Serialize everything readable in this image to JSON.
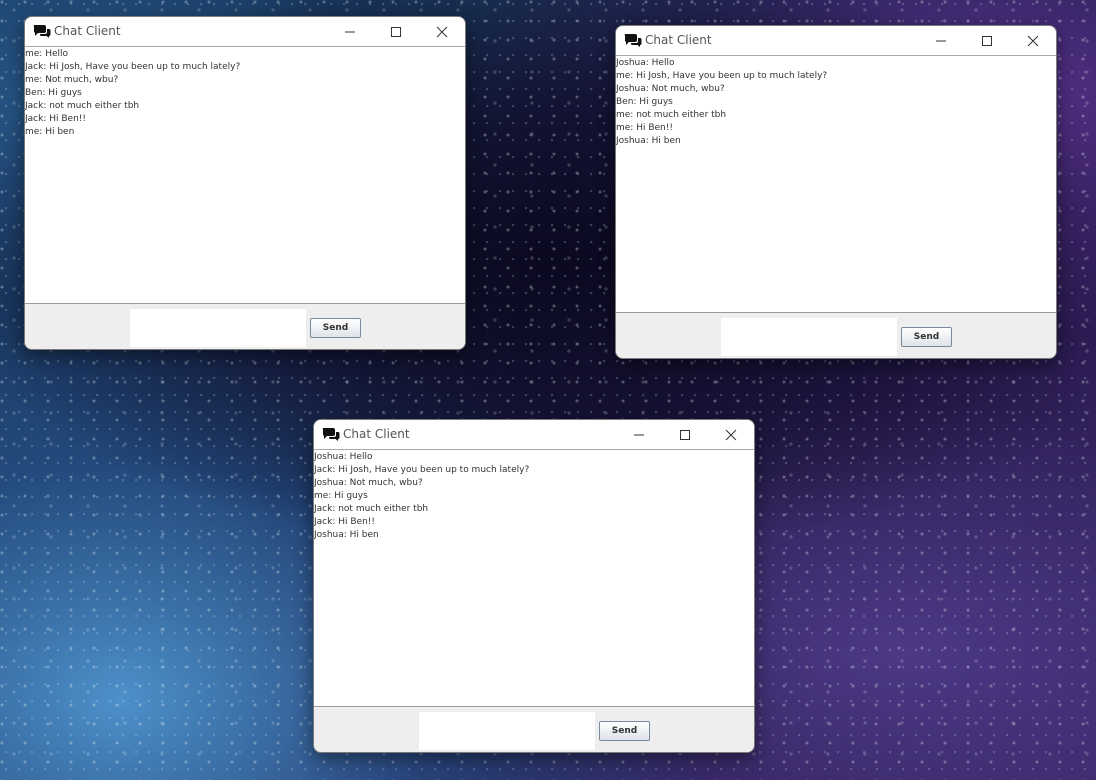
{
  "windows": [
    {
      "title": "Chat Client",
      "messages": [
        "me: Hello",
        "Jack: Hi Josh, Have you been up to much lately?",
        "me: Not much, wbu?",
        "Ben: Hi guys",
        "Jack: not much either tbh",
        "Jack: Hi Ben!!",
        "me: Hi ben"
      ],
      "input_value": "",
      "send_label": "Send"
    },
    {
      "title": "Chat Client",
      "messages": [
        "Joshua: Hello",
        "me: Hi Josh, Have you been up to much lately?",
        "Joshua: Not much, wbu?",
        "Ben: Hi guys",
        "me: not much either tbh",
        "me: Hi Ben!!",
        "Joshua: Hi ben"
      ],
      "input_value": "",
      "send_label": "Send"
    },
    {
      "title": "Chat Client",
      "messages": [
        "Joshua: Hello",
        "Jack: Hi Josh, Have you been up to much lately?",
        "Joshua: Not much, wbu?",
        "me: Hi guys",
        "Jack: not much either tbh",
        "Jack: Hi Ben!!",
        "Joshua: Hi ben"
      ],
      "input_value": "",
      "send_label": "Send"
    }
  ],
  "icons": {
    "app": "chat-bubbles-icon",
    "minimize": "minimize-icon",
    "maximize": "maximize-icon",
    "close": "close-icon"
  }
}
